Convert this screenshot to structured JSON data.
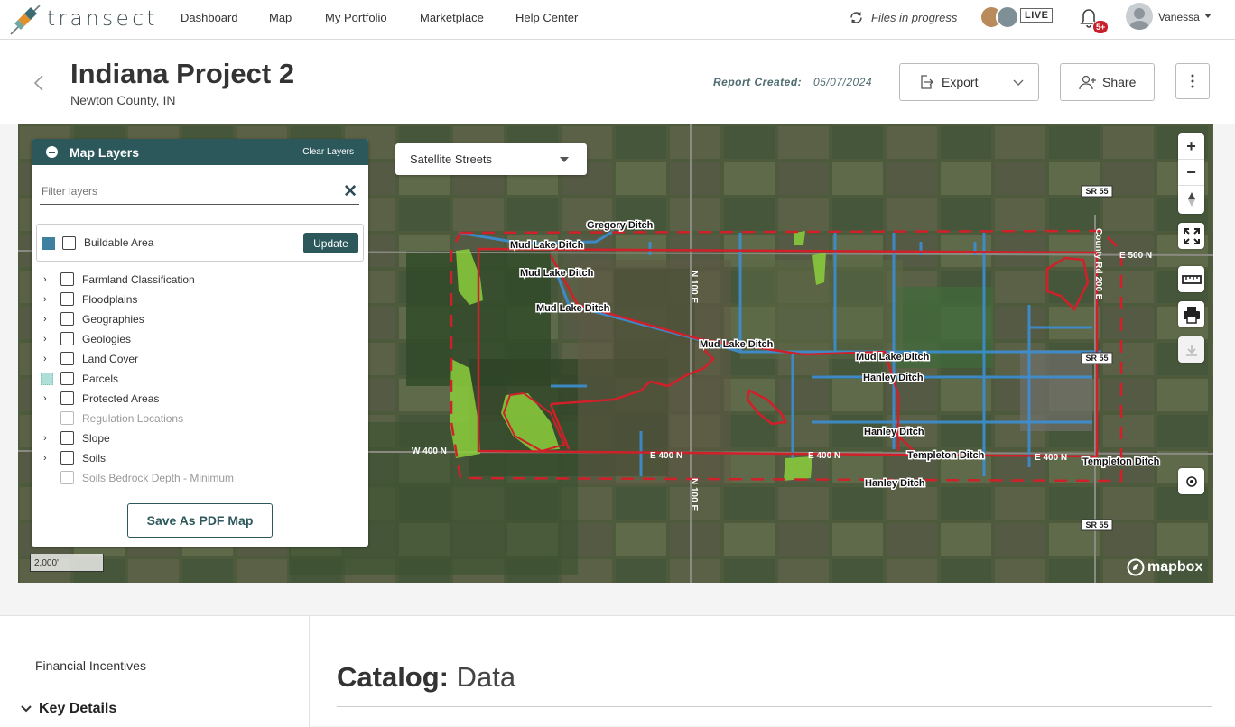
{
  "app": {
    "brand": "transect"
  },
  "nav": {
    "links": [
      "Dashboard",
      "Map",
      "My Portfolio",
      "Marketplace",
      "Help Center"
    ],
    "files_in_progress": "Files in progress",
    "live_badge": "LIVE",
    "notification_badge": "5+",
    "user_name": "Vanessa"
  },
  "project": {
    "title": "Indiana Project 2",
    "subtitle": "Newton County, IN",
    "report_created_label": "Report Created:",
    "report_created_date": "05/07/2024"
  },
  "actions": {
    "export_label": "Export",
    "share_label": "Share"
  },
  "map_layers": {
    "title": "Map Layers",
    "clear_label": "Clear Layers",
    "filter_placeholder": "Filter layers",
    "buildable": {
      "label": "Buildable Area",
      "swatch_color": "#3f7fa0"
    },
    "update_label": "Update",
    "items": [
      {
        "label": "Farmland Classification",
        "expandable": true,
        "disabled": false
      },
      {
        "label": "Floodplains",
        "expandable": true,
        "disabled": false
      },
      {
        "label": "Geographies",
        "expandable": true,
        "disabled": false
      },
      {
        "label": "Geologies",
        "expandable": true,
        "disabled": false
      },
      {
        "label": "Land Cover",
        "expandable": true,
        "disabled": false
      },
      {
        "label": "Parcels",
        "expandable": false,
        "disabled": false
      },
      {
        "label": "Protected Areas",
        "expandable": true,
        "disabled": false
      },
      {
        "label": "Regulation Locations",
        "expandable": false,
        "disabled": true
      },
      {
        "label": "Slope",
        "expandable": true,
        "disabled": false
      },
      {
        "label": "Soils",
        "expandable": true,
        "disabled": false
      },
      {
        "label": "Soils Bedrock Depth - Minimum",
        "expandable": false,
        "disabled": true
      }
    ],
    "save_pdf_label": "Save As PDF Map"
  },
  "map": {
    "basemap_selected": "Satellite Streets",
    "scale_label": "2,000'",
    "attribution": "mapbox",
    "boundary_color": "#d0202a",
    "ditch_color": "#3c8fd4",
    "buildable_color": "#8ccf3c",
    "labels": [
      "Gregory Ditch",
      "Mud Lake Ditch",
      "Mud Lake Ditch",
      "Mud Lake Ditch",
      "Mud Lake Ditch",
      "Mud Lake Ditch",
      "Hanley Ditch",
      "Hanley Ditch",
      "Hanley Ditch",
      "Templeton Ditch",
      "Templeton Ditch",
      "W 400 N",
      "E 400 N",
      "E 400 N",
      "E 400 N",
      "E 500 N",
      "N 100 E",
      "N 100 E",
      "County Rd 200 E"
    ],
    "shields": [
      "SR 55",
      "SR 55",
      "SR 55"
    ]
  },
  "bottom": {
    "financial_incentives": "Financial Incentives",
    "key_details": "Key Details",
    "catalog_bold": "Catalog:",
    "catalog_rest": " Data"
  }
}
